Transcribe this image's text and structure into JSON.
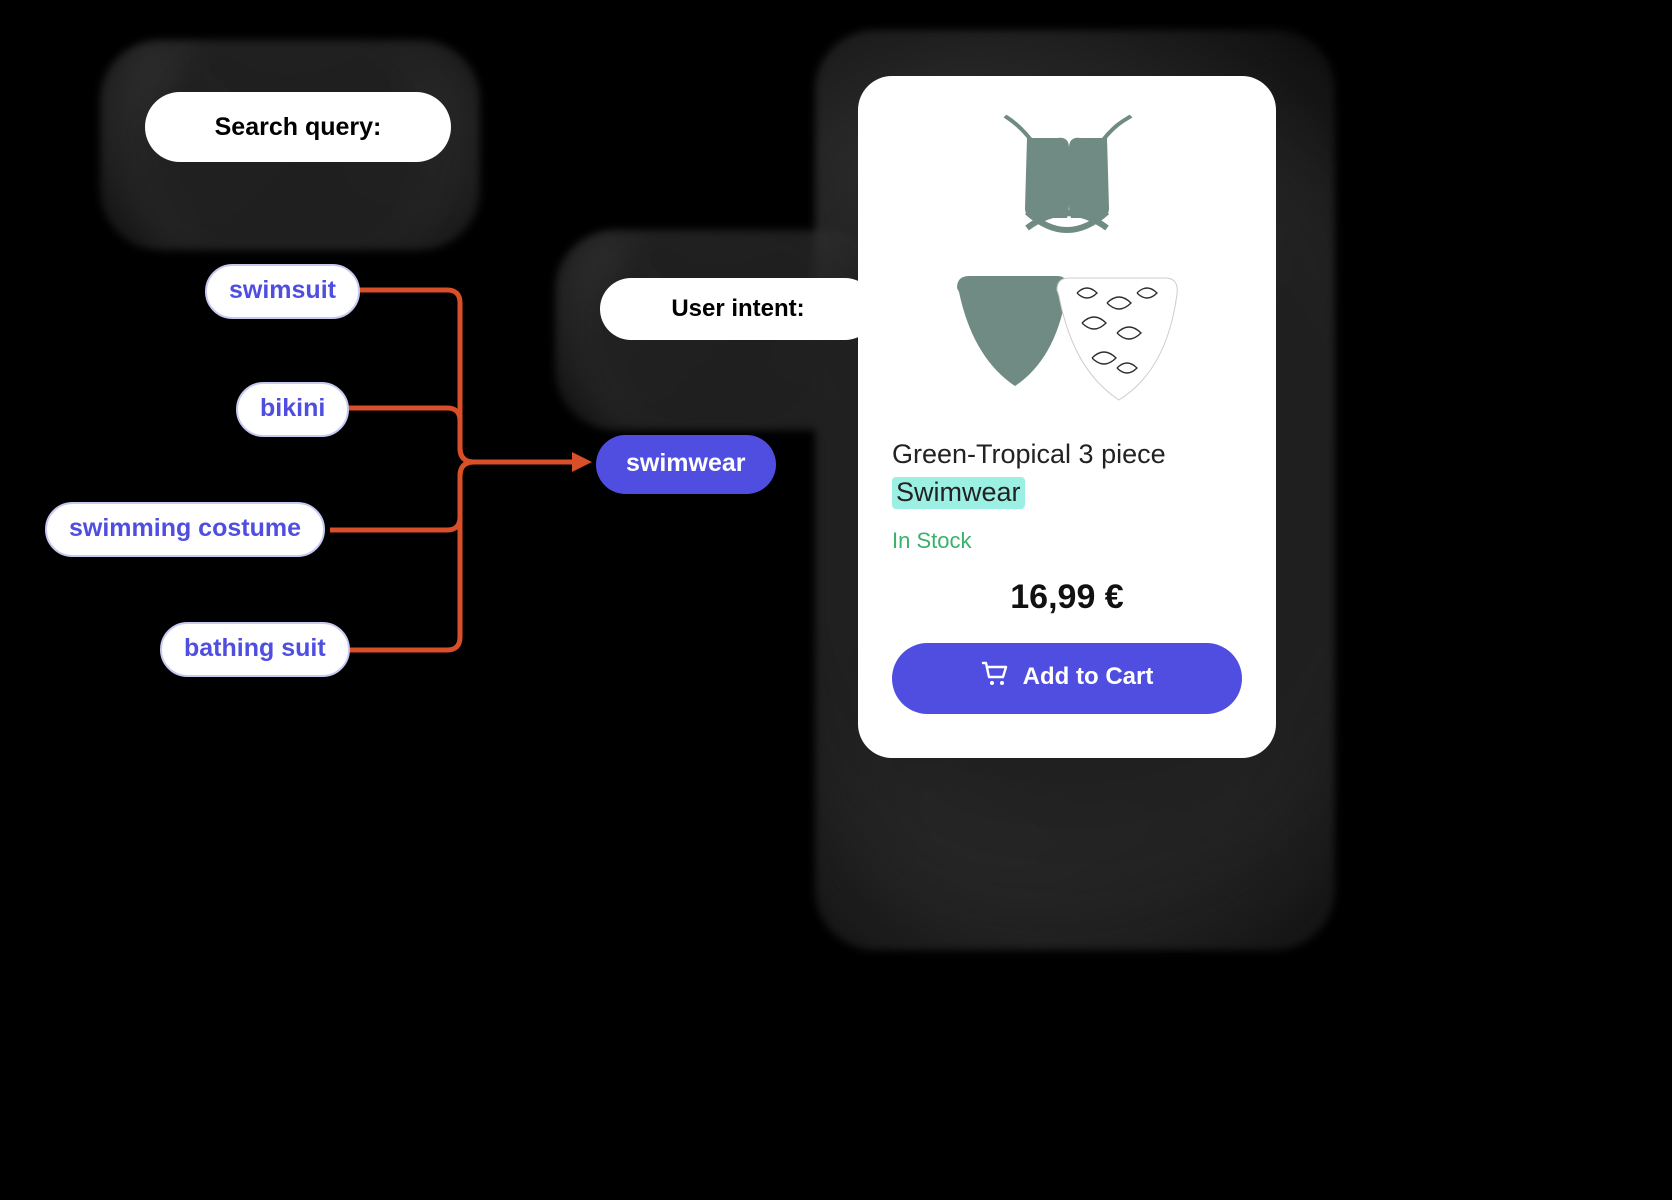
{
  "searchQueryLabel": "Search query:",
  "userIntentLabel": "User intent:",
  "synonyms": {
    "s0": "swimsuit",
    "s1": "bikini",
    "s2": "swimming costume",
    "s3": "bathing suit"
  },
  "userIntentValue": "swimwear",
  "product": {
    "titlePrefix": "Green-Tropical 3 piece",
    "titleHighlighted": "Swimwear",
    "stock": "In Stock",
    "price": "16,99 €",
    "button": "Add to Cart"
  },
  "colors": {
    "accent": "#4f4ee0",
    "connector": "#d94f28",
    "highlight": "#9cf0e3",
    "inStock": "#39b26a"
  }
}
